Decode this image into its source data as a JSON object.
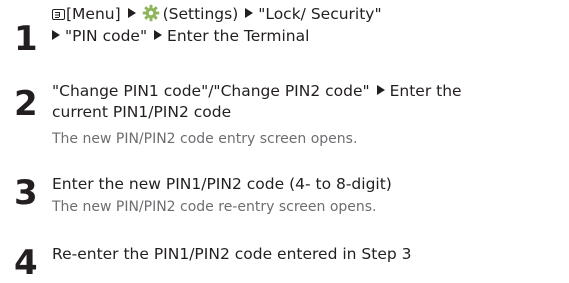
{
  "steps": [
    {
      "number": "1",
      "line1_part1": "[Menu]",
      "line1_part2": "(Settings)",
      "line1_part3": "\"Lock/ Security\"",
      "line2_part1": "\"PIN code\"",
      "line2_part2": "Enter the Terminal"
    },
    {
      "number": "2",
      "line1_part1": "\"Change PIN1 code\"/\"Change PIN2 code\"",
      "line1_part2": "Enter the",
      "line2": "current PIN1/PIN2 code",
      "note": "The new PIN/PIN2 code entry screen opens."
    },
    {
      "number": "3",
      "line1": "Enter the new PIN1/PIN2 code (4- to 8-digit)",
      "note": "The new PIN/PIN2 code re-entry screen opens."
    },
    {
      "number": "4",
      "line1": "Re-enter the PIN1/PIN2 code entered in Step 3"
    }
  ],
  "icons": {
    "menu": "menu-key-icon",
    "settings": "gear-icon",
    "arrow": "triangle-right-icon"
  },
  "colors": {
    "text": "#231f20",
    "note": "#6d6e71",
    "gear": "#8fb55a"
  }
}
